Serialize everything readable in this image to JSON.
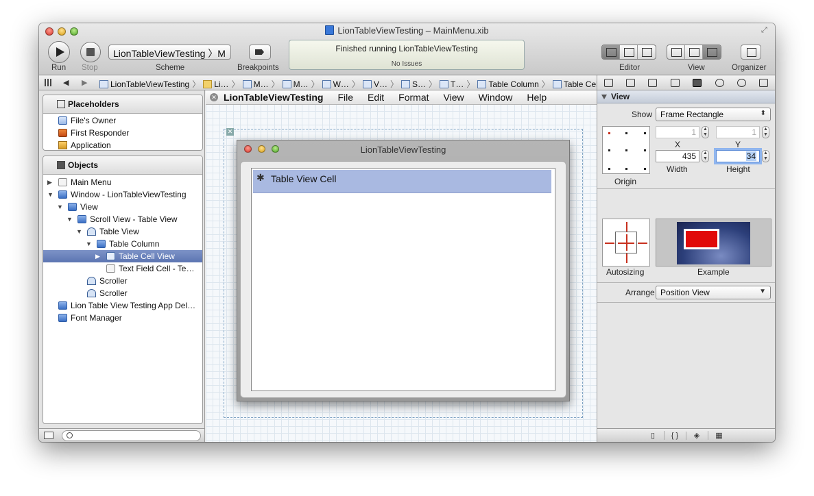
{
  "window": {
    "title": "LionTableViewTesting – MainMenu.xib"
  },
  "toolbar": {
    "run_label": "Run",
    "stop_label": "Stop",
    "scheme_label": "Scheme",
    "scheme_value": "LionTableViewTesting 〉M",
    "breakpoints_label": "Breakpoints",
    "status_main": "Finished running LionTableViewTesting",
    "status_sub": "No Issues",
    "editor_label": "Editor",
    "view_label": "View",
    "organizer_label": "Organizer"
  },
  "jumpbar": {
    "crumbs": [
      {
        "label": "LionTableViewTesting",
        "icon": "xcode-project-icon"
      },
      {
        "label": "Li…",
        "icon": "folder-icon"
      },
      {
        "label": "M…",
        "icon": "xib-icon"
      },
      {
        "label": "M…",
        "icon": "main-menu-icon"
      },
      {
        "label": "W…",
        "icon": "window-icon"
      },
      {
        "label": "V…",
        "icon": "view-icon"
      },
      {
        "label": "S…",
        "icon": "scroll-view-icon"
      },
      {
        "label": "T…",
        "icon": "table-view-icon"
      },
      {
        "label": "Table Column",
        "icon": "table-column-icon"
      },
      {
        "label": "Table Cell View",
        "icon": "table-cell-view-icon"
      }
    ]
  },
  "outline": {
    "placeholders_header": "Placeholders",
    "placeholders": [
      {
        "label": "File's Owner",
        "icon": "files-owner-icon"
      },
      {
        "label": "First Responder",
        "icon": "first-responder-icon"
      },
      {
        "label": "Application",
        "icon": "application-icon"
      }
    ],
    "objects_header": "Objects",
    "objects": [
      {
        "label": "Main Menu",
        "indent": 0,
        "disclosure": "▶",
        "icon": "menu-icon"
      },
      {
        "label": "Window - LionTableViewTesting",
        "indent": 0,
        "disclosure": "▼",
        "icon": "window-icon"
      },
      {
        "label": "View",
        "indent": 1,
        "disclosure": "▼",
        "icon": "view-icon"
      },
      {
        "label": "Scroll View - Table View",
        "indent": 2,
        "disclosure": "▼",
        "icon": "scroll-view-icon"
      },
      {
        "label": "Table View",
        "indent": 3,
        "disclosure": "▼",
        "icon": "table-view-icon"
      },
      {
        "label": "Table Column",
        "indent": 4,
        "disclosure": "▼",
        "icon": "table-column-icon"
      },
      {
        "label": "Table Cell View",
        "indent": 5,
        "disclosure": "▶",
        "icon": "table-cell-view-icon",
        "selected": true
      },
      {
        "label": "Text Field Cell - Te…",
        "indent": 5,
        "disclosure": "",
        "icon": "text-field-cell-icon"
      },
      {
        "label": "Scroller",
        "indent": 3,
        "disclosure": "",
        "icon": "scroller-icon"
      },
      {
        "label": "Scroller",
        "indent": 3,
        "disclosure": "",
        "icon": "scroller-icon"
      },
      {
        "label": "Lion Table View Testing App Del…",
        "indent": 0,
        "disclosure": "",
        "icon": "object-cube-icon"
      },
      {
        "label": "Font Manager",
        "indent": 0,
        "disclosure": "",
        "icon": "object-cube-icon"
      }
    ]
  },
  "canvas": {
    "menu_items": [
      "LionTableViewTesting",
      "File",
      "Edit",
      "Format",
      "View",
      "Window",
      "Help"
    ],
    "window_title": "LionTableViewTesting",
    "cell_label": "Table View Cell"
  },
  "inspector": {
    "section_title": "View",
    "show_label": "Show",
    "show_value": "Frame Rectangle",
    "x_value": "1",
    "y_value": "1",
    "x_label": "X",
    "y_label": "Y",
    "width_value": "435",
    "height_value": "34",
    "width_label": "Width",
    "height_label": "Height",
    "origin_label": "Origin",
    "autosizing_label": "Autosizing",
    "example_label": "Example",
    "arrange_label": "Arrange",
    "arrange_value": "Position View"
  },
  "colors": {
    "selection": "#5c75b2",
    "accent": "#3a78d8",
    "strut": "#c8301e"
  }
}
